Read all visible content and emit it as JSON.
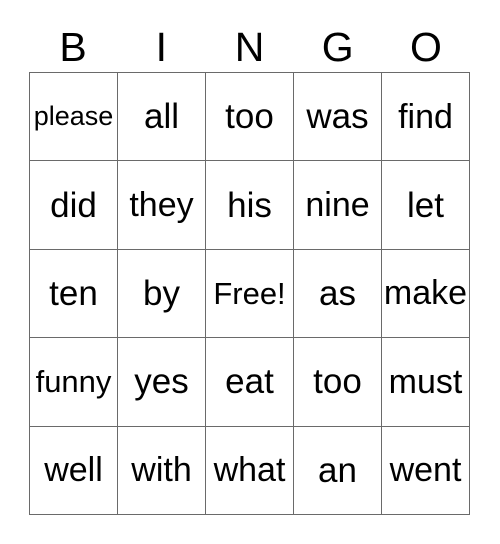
{
  "card": {
    "type": "bingo-card",
    "columns": 5,
    "rows": 5,
    "header": {
      "letters": [
        "B",
        "I",
        "N",
        "G",
        "O"
      ]
    },
    "colors": {
      "background": "#ffffff",
      "text": "#000000",
      "grid_line": "#6a6a6a"
    },
    "free_space": {
      "label": "Free!",
      "row": 3,
      "column": 3
    },
    "grid": [
      [
        "please",
        "all",
        "too",
        "was",
        "find"
      ],
      [
        "did",
        "they",
        "his",
        "nine",
        "let"
      ],
      [
        "ten",
        "by",
        "Free!",
        "as",
        "make"
      ],
      [
        "funny",
        "yes",
        "eat",
        "too",
        "must"
      ],
      [
        "well",
        "with",
        "what",
        "an",
        "went"
      ]
    ]
  }
}
